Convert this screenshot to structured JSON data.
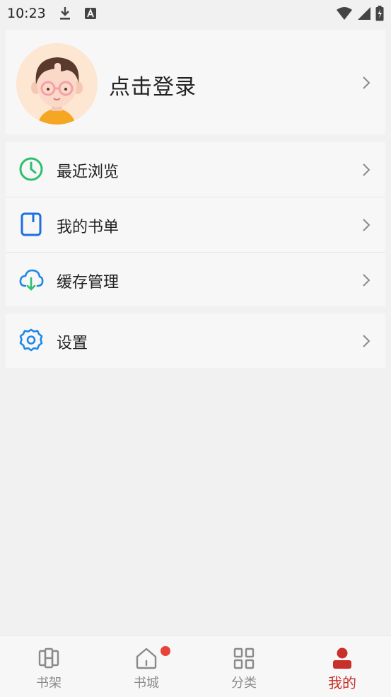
{
  "status_bar": {
    "time": "10:23"
  },
  "profile": {
    "login_label": "点击登录"
  },
  "menu": {
    "items": [
      {
        "label": "最近浏览",
        "icon": "clock-icon",
        "color": "#2fbf6f"
      },
      {
        "label": "我的书单",
        "icon": "booklist-icon",
        "color": "#1e6fe0"
      },
      {
        "label": "缓存管理",
        "icon": "cloud-download-icon",
        "color": "#1e88e5"
      }
    ]
  },
  "settings": {
    "label": "设置",
    "icon": "gear-icon",
    "color": "#1e88e5"
  },
  "tabbar": {
    "tabs": [
      {
        "label": "书架",
        "icon": "bookshelf-icon"
      },
      {
        "label": "书城",
        "icon": "home-icon",
        "badge": true
      },
      {
        "label": "分类",
        "icon": "grid-icon"
      },
      {
        "label": "我的",
        "icon": "user-icon",
        "active": true
      }
    ],
    "active_color": "#c8312b",
    "inactive_color": "#8a8a8a"
  }
}
